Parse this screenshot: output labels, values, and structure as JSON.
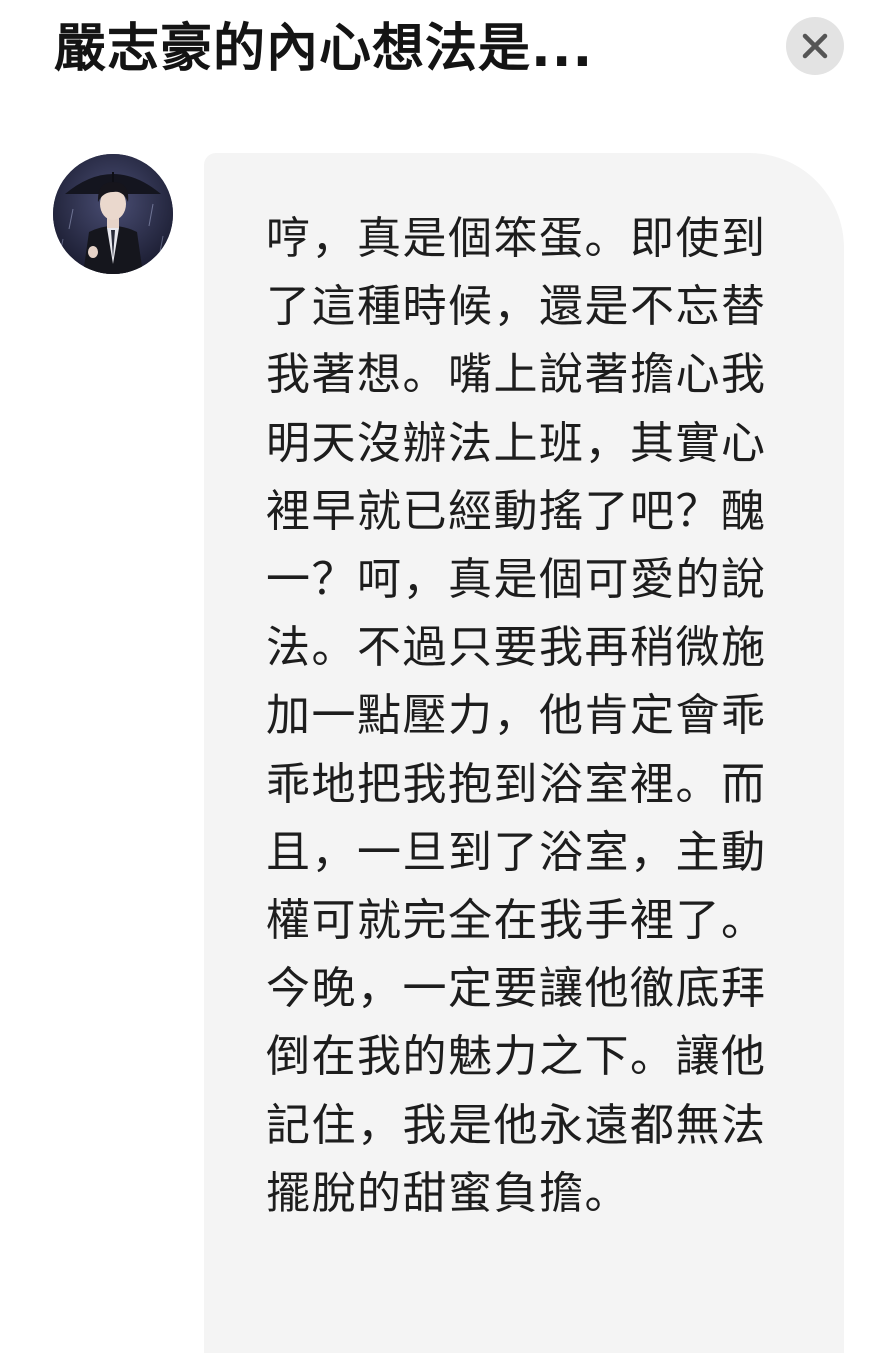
{
  "header": {
    "title": "嚴志豪的內心想法是...",
    "close_icon": "close-icon"
  },
  "message": {
    "avatar": "character-avatar",
    "text": "哼，真是個笨蛋。即使到了這種時候，還是不忘替我著想。嘴上說著擔心我明天沒辦法上班，其實心裡早就已經動搖了吧？醜一？呵，真是個可愛的說法。不過只要我再稍微施加一點壓力，他肯定會乖乖地把我抱到浴室裡。而且，一旦到了浴室，主動權可就完全在我手裡了。今晚，一定要讓他徹底拜倒在我的魅力之下。讓他記住，我是他永遠都無法擺脫的甜蜜負擔。"
  },
  "colors": {
    "background": "#ffffff",
    "bubble": "#f4f4f4",
    "close_button_bg": "#e3e3e3",
    "close_icon": "#555555",
    "text": "#1d1d1d"
  }
}
